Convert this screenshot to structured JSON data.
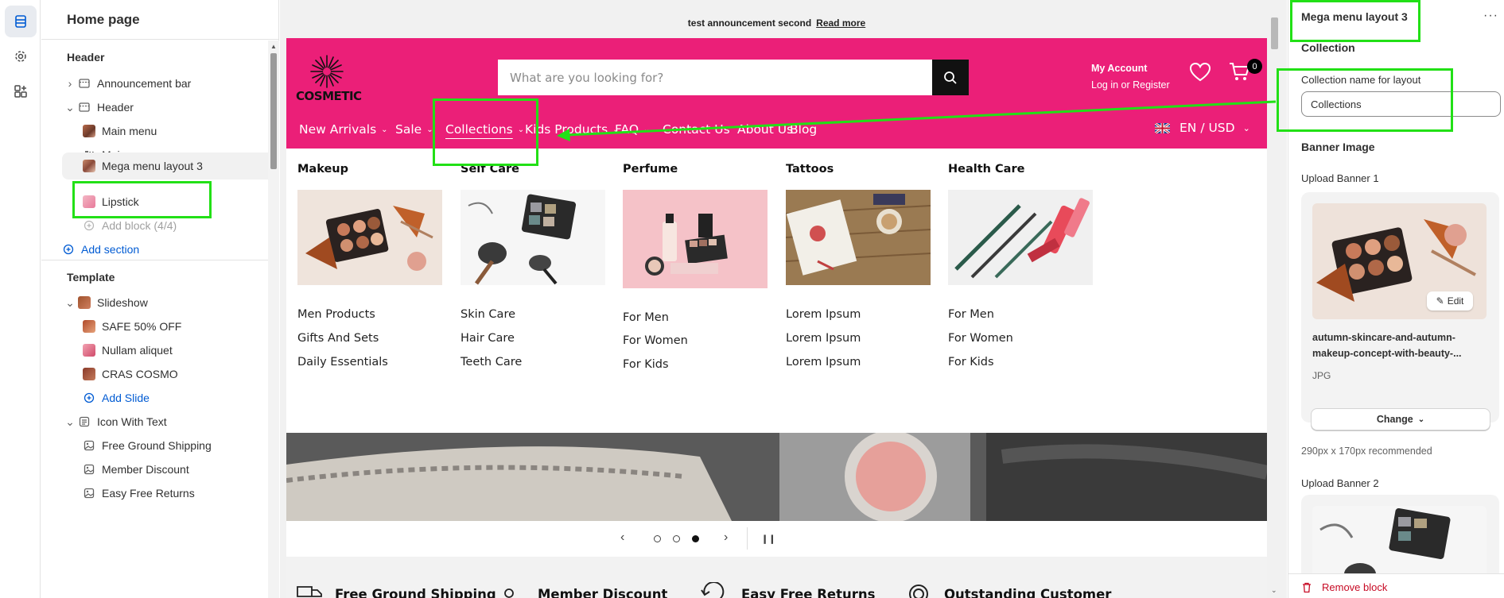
{
  "sidebar": {
    "title": "Home page",
    "header_group": "Header",
    "items": [
      {
        "label": "Announcement bar"
      },
      {
        "label": "Header"
      },
      {
        "label": "Main menu"
      },
      {
        "label": "Main menu"
      },
      {
        "label": "Mega menu layout 3"
      },
      {
        "label": "Lipstick"
      },
      {
        "label": "Add block (4/4)"
      },
      {
        "label": "Add section"
      }
    ],
    "template_group": "Template",
    "template_items": [
      {
        "label": "Slideshow"
      },
      {
        "label": "SAFE 50% OFF"
      },
      {
        "label": "Nullam aliquet"
      },
      {
        "label": "CRAS COSMO"
      },
      {
        "label": "Add Slide"
      },
      {
        "label": "Icon With Text"
      },
      {
        "label": "Free Ground Shipping"
      },
      {
        "label": "Member Discount"
      },
      {
        "label": "Easy Free Returns"
      }
    ]
  },
  "preview": {
    "announcement": "test announcement second",
    "announcement_link": "Read more",
    "logo_text": "COSMETIC",
    "search_placeholder": "What are you looking for?",
    "account_title": "My Account",
    "account_link": "Log in or Register",
    "cart_count": "0",
    "nav": [
      {
        "label": "New Arrivals"
      },
      {
        "label": "Sale"
      },
      {
        "label": "Collections"
      },
      {
        "label": "Kids Products"
      },
      {
        "label": "FAQ"
      },
      {
        "label": "Contact Us"
      },
      {
        "label": "About Us"
      },
      {
        "label": "Blog"
      }
    ],
    "locale": "EN / USD",
    "mega": [
      {
        "title": "Makeup",
        "links": [
          "Men Products",
          "Gifts And Sets",
          "Daily Essentials"
        ]
      },
      {
        "title": "Self Care",
        "links": [
          "Skin Care",
          "Hair Care",
          "Teeth Care"
        ]
      },
      {
        "title": "Perfume",
        "links": [
          "For Men",
          "For Women",
          "For Kids"
        ]
      },
      {
        "title": "Tattoos",
        "links": [
          "Lorem Ipsum",
          "Lorem Ipsum",
          "Lorem Ipsum"
        ]
      },
      {
        "title": "Health Care",
        "links": [
          "For Men",
          "For Women",
          "For Kids"
        ]
      }
    ],
    "features": [
      "Free Ground Shipping",
      "Member Discount",
      "Easy Free Returns",
      "Outstanding Customer"
    ]
  },
  "panel": {
    "title": "Mega menu layout 3",
    "section": "Collection",
    "field_label": "Collection name for layout",
    "field_value": "Collections",
    "banner_heading": "Banner Image",
    "upload1": "Upload Banner 1",
    "edit": "Edit",
    "filename": "autumn-skincare-and-autumn-makeup-concept-with-beauty-...",
    "filetype": "JPG",
    "change": "Change",
    "recommend": "290px x 170px recommended",
    "upload2": "Upload Banner 2",
    "remove": "Remove block"
  },
  "colors": {
    "brand": "#eb1f78",
    "highlight": "#22e016",
    "link": "#005bd3",
    "danger": "#c70a24"
  }
}
